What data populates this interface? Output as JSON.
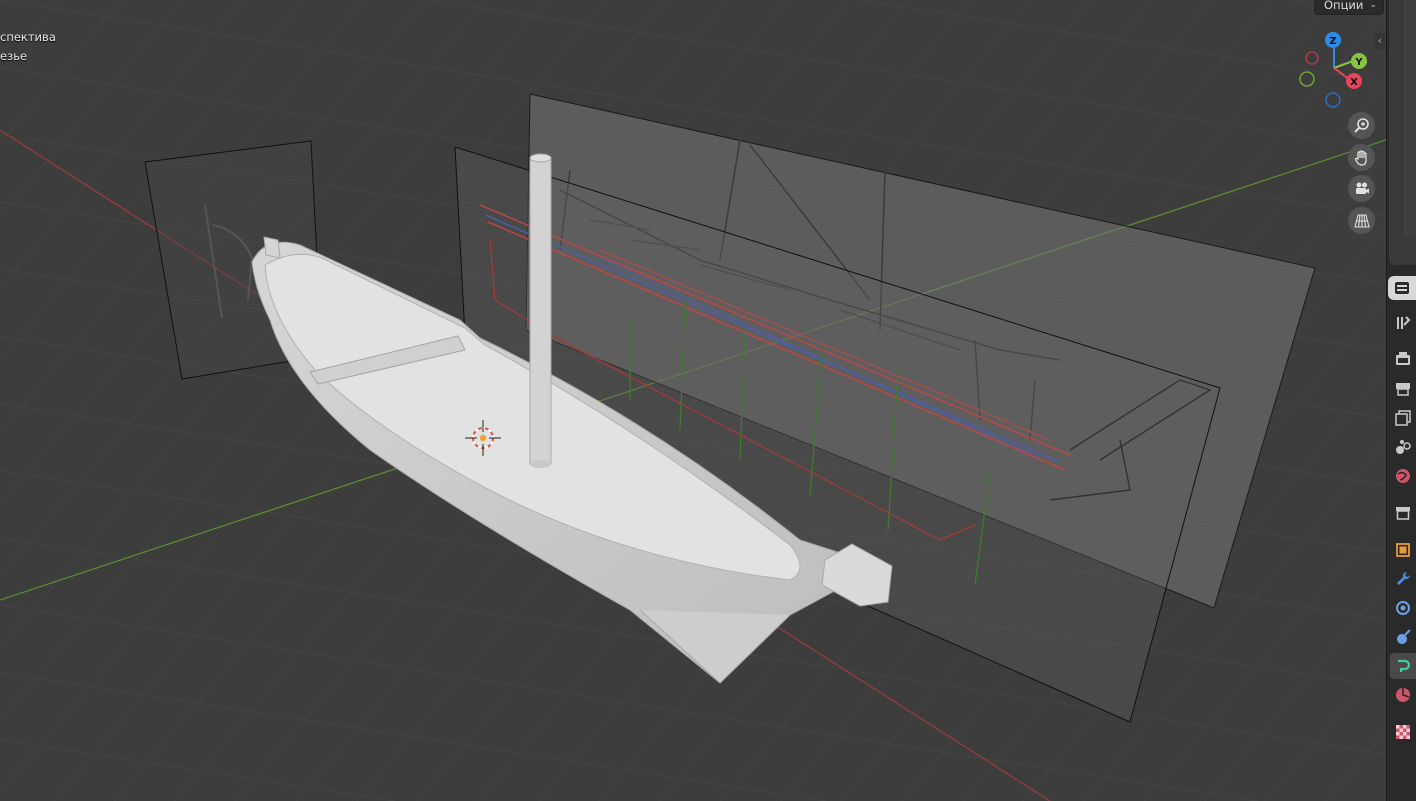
{
  "viewport": {
    "info_lines": [
      "спектива",
      "езье"
    ],
    "options_label": "Опции",
    "colors": {
      "background": "#3d3d3d",
      "axis_x": "#9b3a3a",
      "axis_y": "#5d8a2e"
    }
  },
  "gizmo": {
    "axes": [
      "Z",
      "Y",
      "X"
    ],
    "colors": {
      "x": "#e8445a",
      "y": "#8ac43e",
      "z": "#2d8ceb"
    }
  },
  "nav_buttons": [
    {
      "icon": "zoom-icon"
    },
    {
      "icon": "hand-pan-icon"
    },
    {
      "icon": "camera-view-icon"
    },
    {
      "icon": "perspective-grid-icon"
    }
  ],
  "properties_tabs": [
    {
      "icon": "tool-icon"
    },
    {
      "icon": "render-icon"
    },
    {
      "icon": "output-icon"
    },
    {
      "icon": "view-layer-icon"
    },
    {
      "icon": "scene-icon"
    },
    {
      "icon": "world-icon"
    },
    {
      "icon": "collection-icon"
    },
    {
      "icon": "object-icon"
    },
    {
      "icon": "modifier-wrench-icon"
    },
    {
      "icon": "particles-icon"
    },
    {
      "icon": "physics-icon"
    },
    {
      "icon": "constraints-icon",
      "active": true
    },
    {
      "icon": "data-icon"
    },
    {
      "icon": "texture-checker-icon"
    }
  ]
}
